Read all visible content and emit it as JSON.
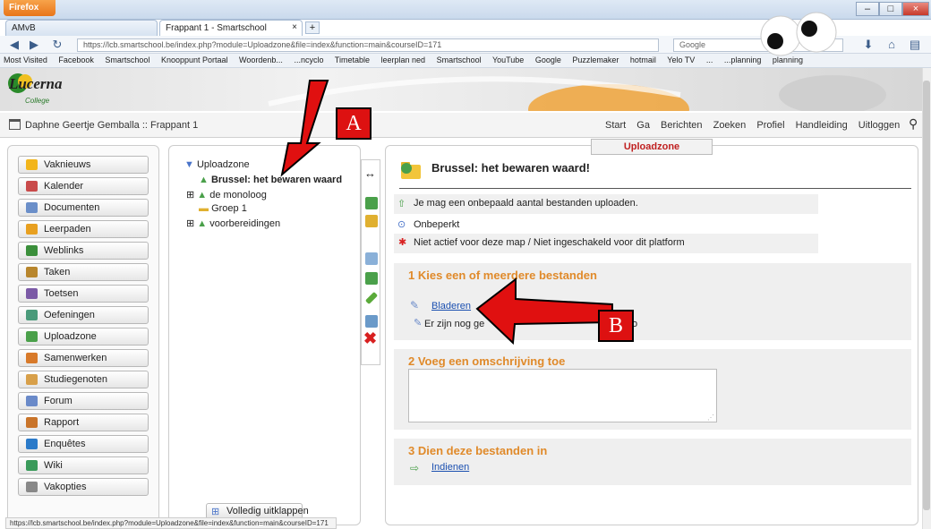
{
  "browser": {
    "app_button": "Firefox",
    "tabs": [
      {
        "label": "AMvB"
      },
      {
        "label": "Frappant 1 - Smartschool"
      }
    ],
    "new_tab": "+",
    "window_controls": {
      "minimize": "–",
      "maximize": "□",
      "close": "×"
    },
    "url": "https://lcb.smartschool.be/index.php?module=Uploadzone&file=index&function=main&courseID=171",
    "search_placeholder": "Google",
    "bookmarks": [
      "Most Visited",
      "Facebook",
      "Smartschool",
      "Knooppunt Portaal",
      "Woordenb...",
      "...ncyclo",
      "Timetable",
      "leerplan ned",
      "Smartschool",
      "YouTube",
      "Google",
      "Puzzlemaker",
      "hotmail",
      "Yelo TV",
      "...",
      "...planning",
      "planning"
    ],
    "status_url": "https://lcb.smartschool.be/index.php?module=Uploadzone&file=index&function=main&courseID=171"
  },
  "site": {
    "logo": "Lucerna",
    "logo_sub": "College",
    "breadcrumb": "Daphne Geertje Gemballa :: Frappant 1",
    "top_menu": [
      "Start",
      "Ga",
      "Berichten",
      "Zoeken",
      "Profiel",
      "Handleiding",
      "Uitloggen"
    ]
  },
  "module_tab": "Uploadzone",
  "sidebar": {
    "items": [
      {
        "label": "Vaknieuws",
        "color": "#f2b51b"
      },
      {
        "label": "Kalender",
        "color": "#c94a4a"
      },
      {
        "label": "Documenten",
        "color": "#6b8fc9"
      },
      {
        "label": "Leerpaden",
        "color": "#e8a020"
      },
      {
        "label": "Weblinks",
        "color": "#3b8f3b"
      },
      {
        "label": "Taken",
        "color": "#b8862d"
      },
      {
        "label": "Toetsen",
        "color": "#7b5aa6"
      },
      {
        "label": "Oefeningen",
        "color": "#4a9a7a"
      },
      {
        "label": "Uploadzone",
        "color": "#4aa04a"
      },
      {
        "label": "Samenwerken",
        "color": "#d87a2a"
      },
      {
        "label": "Studiegenoten",
        "color": "#d8a04a"
      },
      {
        "label": "Forum",
        "color": "#6a8ac9"
      },
      {
        "label": "Rapport",
        "color": "#c9742a"
      },
      {
        "label": "Enquêtes",
        "color": "#2a7ac9"
      },
      {
        "label": "Wiki",
        "color": "#3a9a5a"
      },
      {
        "label": "Vakopties",
        "color": "#888888"
      }
    ]
  },
  "tree": {
    "root": "Uploadzone",
    "items": [
      "Brussel: het bewaren waard",
      "de monoloog",
      "Groep 1",
      "voorbereidingen"
    ],
    "expand_all": "Volledig uitklappen"
  },
  "main": {
    "title": "Brussel: het bewaren waard!",
    "info": [
      "Je mag een onbepaald aantal bestanden uploaden.",
      "Onbeperkt",
      "Niet actief voor deze map / Niet ingeschakeld voor dit platform"
    ],
    "step1": {
      "heading": "1 Kies een of meerdere bestanden",
      "browse": "Bladeren",
      "note_start": "Er zijn nog ge",
      "note_end": "o"
    },
    "step2": {
      "heading": "2 Voeg een omschrijving toe"
    },
    "step3": {
      "heading": "3 Dien deze bestanden in",
      "submit": "Indienen"
    }
  },
  "annotations": {
    "a": "A",
    "b": "B"
  },
  "colors": {
    "arrow": "#e01010",
    "section_heading": "#e08a2a",
    "module_tab": "#c02020"
  }
}
